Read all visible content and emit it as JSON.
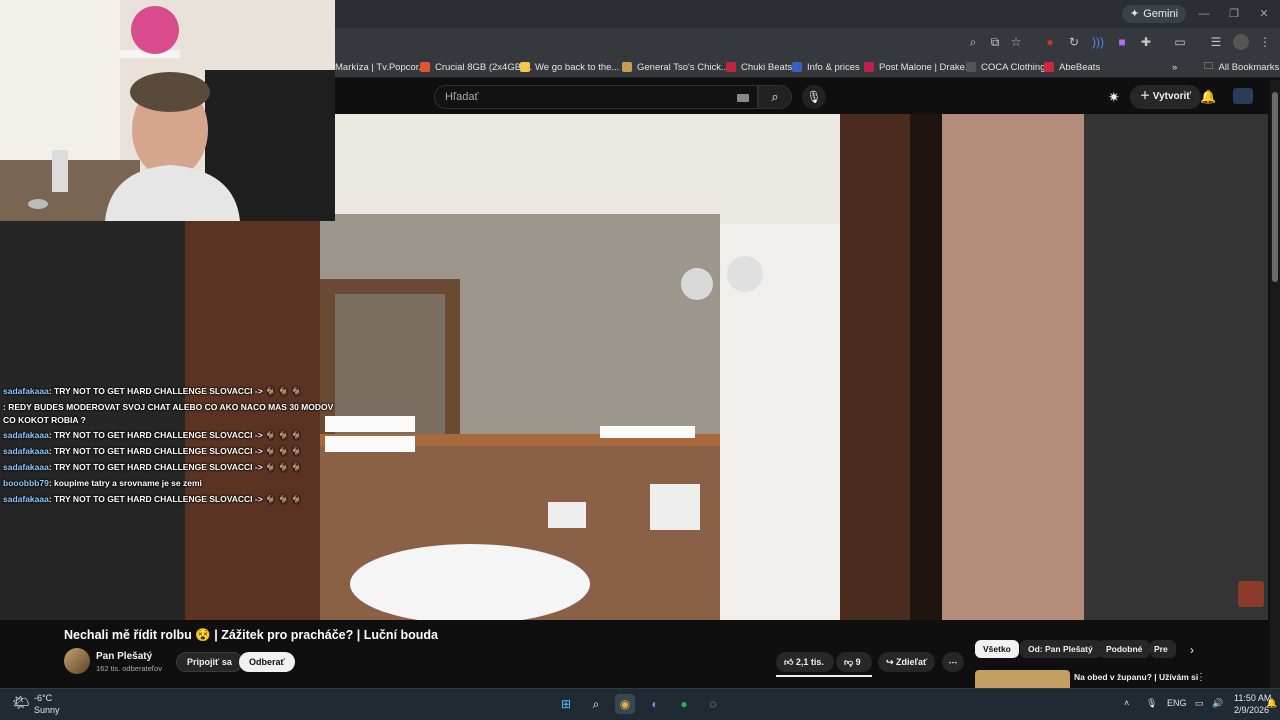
{
  "browser": {
    "gemini_label": "Gemini",
    "bookmarks": [
      {
        "label": "Markíza | Tv.Popcor...",
        "color": "#4a4a4a"
      },
      {
        "label": "Crucial 8GB (2x4GB)...",
        "color": "#e0552b"
      },
      {
        "label": "We go back to the...",
        "color": "#f2c94c"
      },
      {
        "label": "General Tso's Chick...",
        "color": "#c79b52"
      },
      {
        "label": "Chuki Beats",
        "color": "#c2243a"
      },
      {
        "label": "Info & prices",
        "color": "#3b5fc9"
      },
      {
        "label": "Post Malone | Drake...",
        "color": "#c01f4f"
      },
      {
        "label": "COCA Clothing",
        "color": "#555555"
      },
      {
        "label": "AbeBeats",
        "color": "#d3273b"
      }
    ],
    "all_bookmarks_label": "All Bookmarks"
  },
  "youtube": {
    "search_placeholder": "Hľadať",
    "create_label": "Vytvoriť",
    "video_title": "Nechali mě řídit rolbu 😵 | Zážitek pro pracháče? | Luční bouda",
    "channel_name": "Pan Plešatý",
    "subscribers": "162 tis. odberateľov",
    "join_label": "Pripojiť sa",
    "unsubscribe_label": "Odberať",
    "likes": "2,1 tis.",
    "dislikes": "9",
    "share_label": "Zdieľať",
    "more_label": "⋯",
    "chips": [
      "Všetko",
      "Od: Pan Plešatý",
      "Podobné",
      "Pre"
    ],
    "next_video_title_line1": "Na obed v županu? | Užívám si",
    "next_video_title_line2": "..."
  },
  "chat": [
    {
      "user": "sadafakaaa",
      "text": ": TRY NOT TO GET HARD CHALLENGE SLOVACCI -> 🐐 🐐 🐐"
    },
    {
      "user": "",
      "text": ": REDY BUDES MODEROVAT SVOJ CHAT ALEBO CO AKO NACO MAS 30 MODOV"
    },
    {
      "user": "",
      "text": "CO KOKOT ROBIA ?"
    },
    {
      "user": "sadafakaaa",
      "text": ": TRY NOT TO GET HARD CHALLENGE SLOVACCI -> 🐐 🐐 🐐"
    },
    {
      "user": "sadafakaaa",
      "text": ": TRY NOT TO GET HARD CHALLENGE SLOVACCI -> 🐐 🐐 🐐"
    },
    {
      "user": "sadafakaaa",
      "text": ": TRY NOT TO GET HARD CHALLENGE SLOVACCI -> 🐐 🐐 🐐"
    },
    {
      "user": "booobbb79",
      "text": ": koupime tatry a srovname je se zemi"
    },
    {
      "user": "sadafakaaa",
      "text": ": TRY NOT TO GET HARD CHALLENGE SLOVACCI -> 🐐 🐐 🐐"
    }
  ],
  "taskbar": {
    "weather_temp": "-6°C",
    "weather_desc": "Sunny",
    "lang": "ENG",
    "time": "11:50 AM",
    "date": "2/9/2026"
  }
}
